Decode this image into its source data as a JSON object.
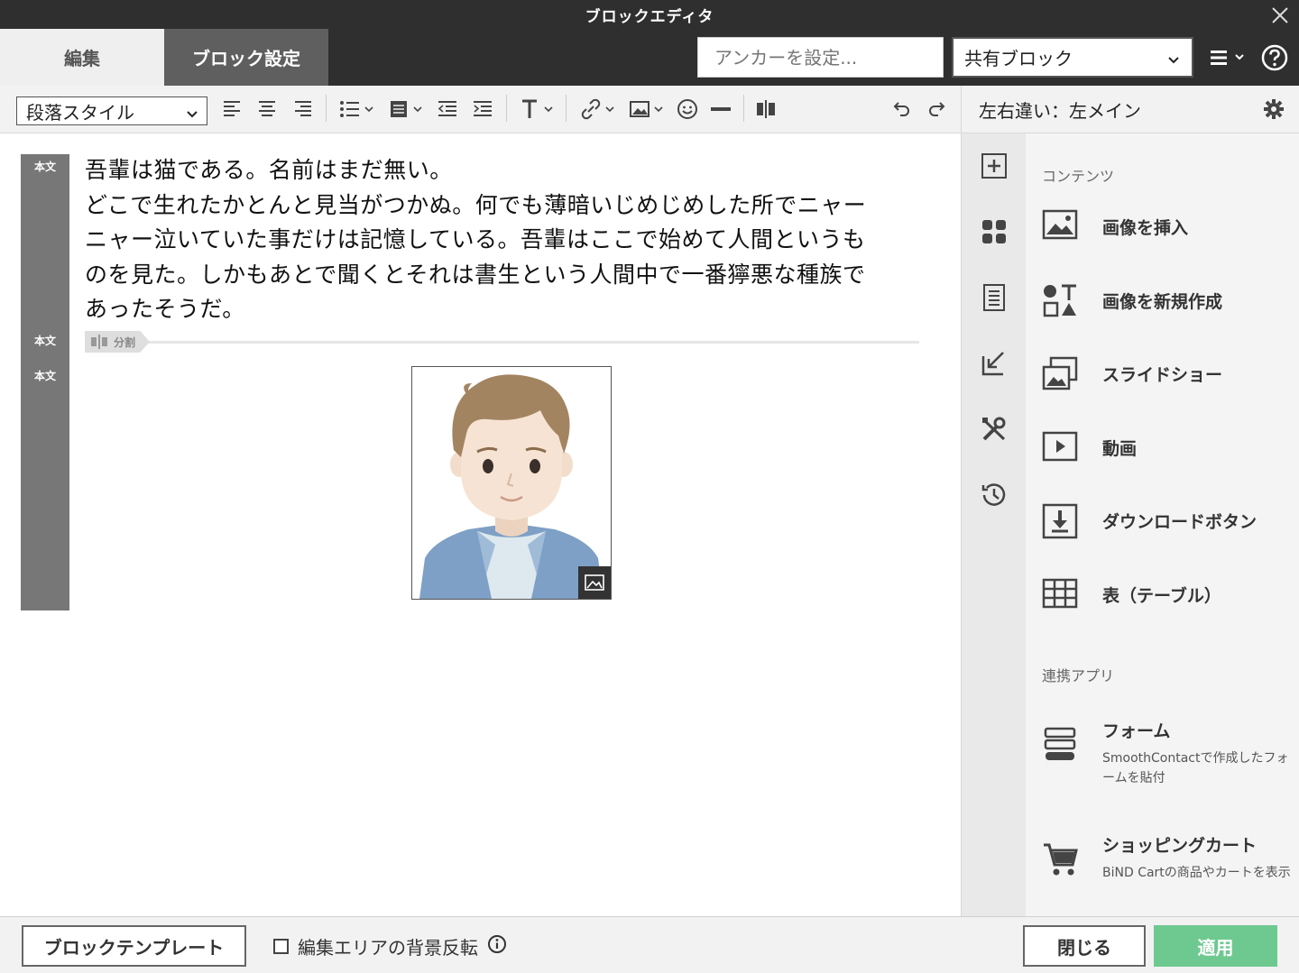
{
  "window": {
    "title": "ブロックエディタ"
  },
  "header": {
    "tabs": [
      {
        "label": "編集",
        "active": false
      },
      {
        "label": "ブロック設定",
        "active": true
      }
    ],
    "anchor_placeholder": "アンカーを設定...",
    "shared_block_value": "共有ブロック"
  },
  "toolbar": {
    "paragraph_style": "段落スタイル",
    "icons": [
      "align-left-icon",
      "align-center-icon",
      "align-right-icon",
      "list-icon",
      "block-icon",
      "outdent-icon",
      "indent-icon",
      "text-style-icon",
      "link-icon",
      "image-icon",
      "emoji-icon",
      "horizontal-rule-icon",
      "split-icon",
      "undo-icon",
      "redo-icon"
    ]
  },
  "panel": {
    "layout_title": "左右違い：左メイン",
    "sections": [
      {
        "title": "コンテンツ",
        "items": [
          {
            "label": "画像を挿入",
            "icon": "image-icon"
          },
          {
            "label": "画像を新規作成",
            "icon": "shapes-icon"
          },
          {
            "label": "スライドショー",
            "icon": "slideshow-icon"
          },
          {
            "label": "動画",
            "icon": "video-icon"
          },
          {
            "label": "ダウンロードボタン",
            "icon": "download-icon"
          },
          {
            "label": "表（テーブル）",
            "icon": "table-icon"
          }
        ]
      },
      {
        "title": "連携アプリ",
        "items": [
          {
            "label": "フォーム",
            "desc": "SmoothContactで作成したフォームを貼付",
            "icon": "form-icon"
          },
          {
            "label": "ショッピングカート",
            "desc": "BiND Cartの商品やカートを表示",
            "icon": "cart-icon"
          }
        ]
      }
    ],
    "rail_icons": [
      "add-block-icon",
      "widgets-icon",
      "page-icon",
      "import-icon",
      "tools-icon",
      "history-icon"
    ]
  },
  "editor": {
    "gutter_labels": [
      "本文",
      "本文",
      "本文"
    ],
    "paragraph_lines": [
      "吾輩は猫である。名前はまだ無い。",
      "どこで生れたかとんと見当がつかぬ。何でも薄暗いじめじめした所でニャー",
      "ニャー泣いていた事だけは記憶している。吾輩はここで始めて人間というも",
      "のを見た。しかもあとで聞くとそれは書生という人間中で一番獰悪な種族で",
      "あったそうだ。"
    ],
    "split_label": "分割"
  },
  "footer": {
    "template_button": "ブロックテンプレート",
    "bg_invert_label": "編集エリアの背景反転",
    "bg_invert_checked": false,
    "close_button": "閉じる",
    "apply_button": "適用"
  },
  "colors": {
    "titlebar": "#2f2f2f",
    "active_tab": "#5f5f5f",
    "apply": "#6ec991",
    "gutter": "#777777"
  }
}
